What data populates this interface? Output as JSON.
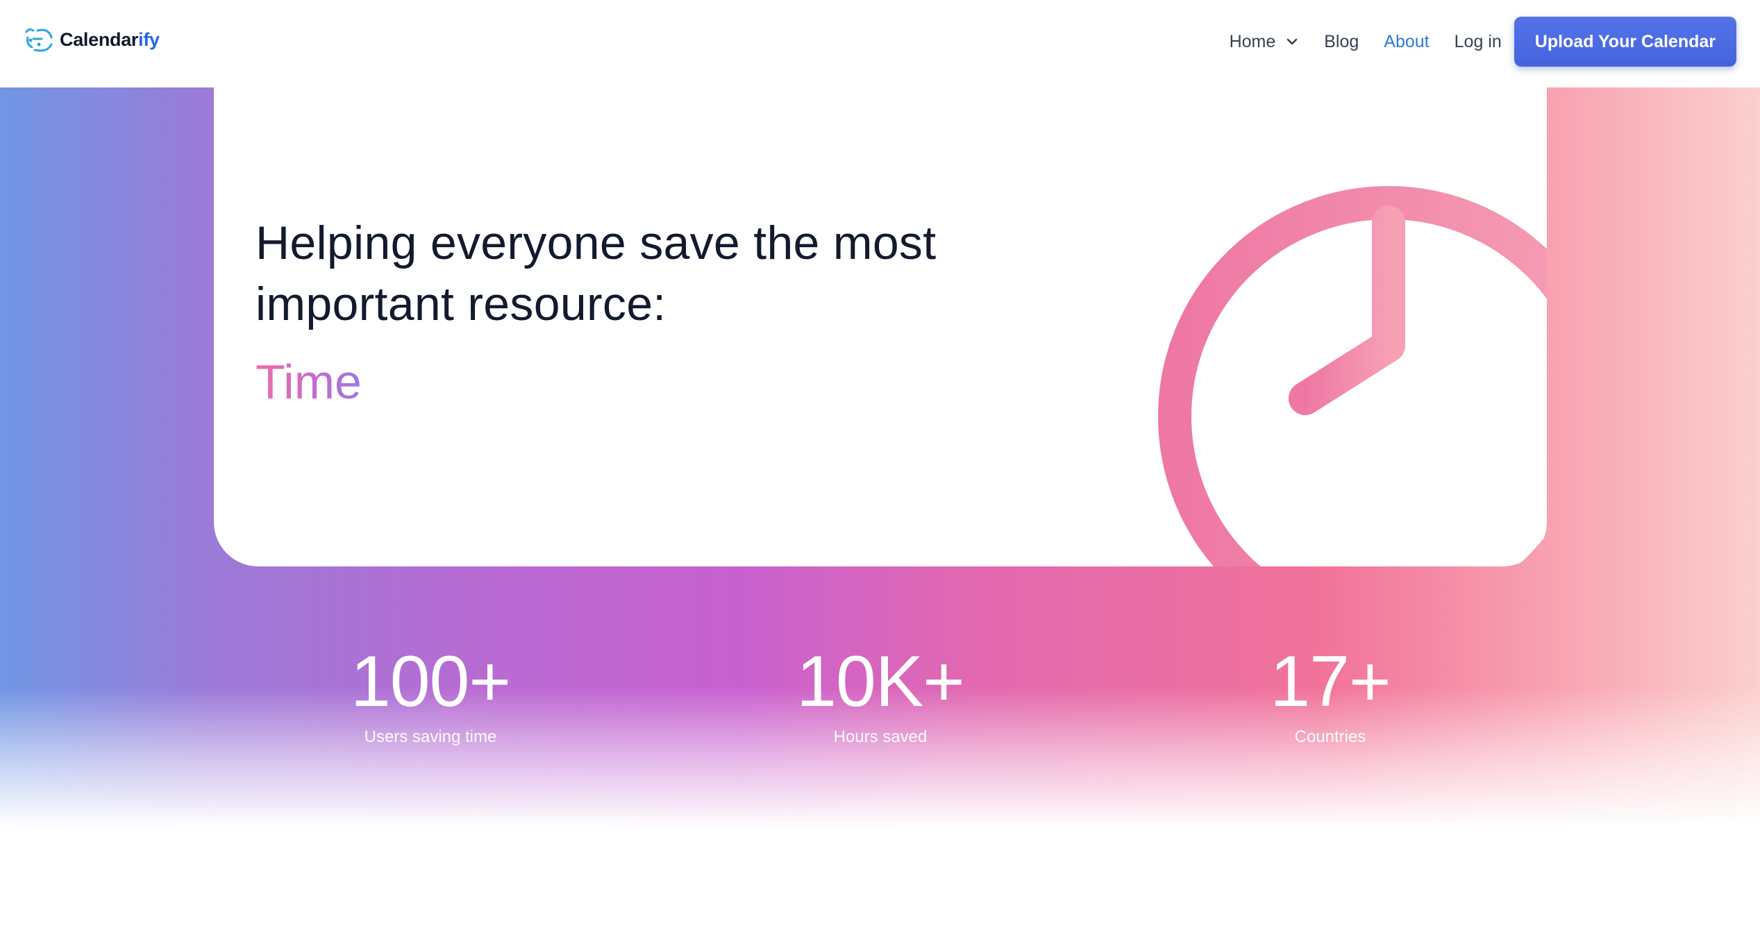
{
  "brand": {
    "name_main": "Calendar",
    "name_accent": "ify"
  },
  "nav": {
    "items": [
      {
        "label": "Home"
      },
      {
        "label": "Blog"
      },
      {
        "label": "About"
      },
      {
        "label": "Log in"
      }
    ],
    "cta_label": "Upload Your Calendar"
  },
  "hero": {
    "title": "Helping everyone save the most important resource:",
    "highlight": "Time"
  },
  "stats": [
    {
      "value": "100+",
      "label": "Users saving time"
    },
    {
      "value": "10K+",
      "label": "Hours saved"
    },
    {
      "value": "17+",
      "label": "Countries"
    }
  ],
  "colors": {
    "accent": "#2563eb",
    "cta": "#4a66e0",
    "nav_active": "#2b7bd6",
    "clock": "#f07aa2"
  },
  "icons": [
    "calendarify-logo-icon",
    "chevron-down-icon",
    "clock-icon"
  ]
}
